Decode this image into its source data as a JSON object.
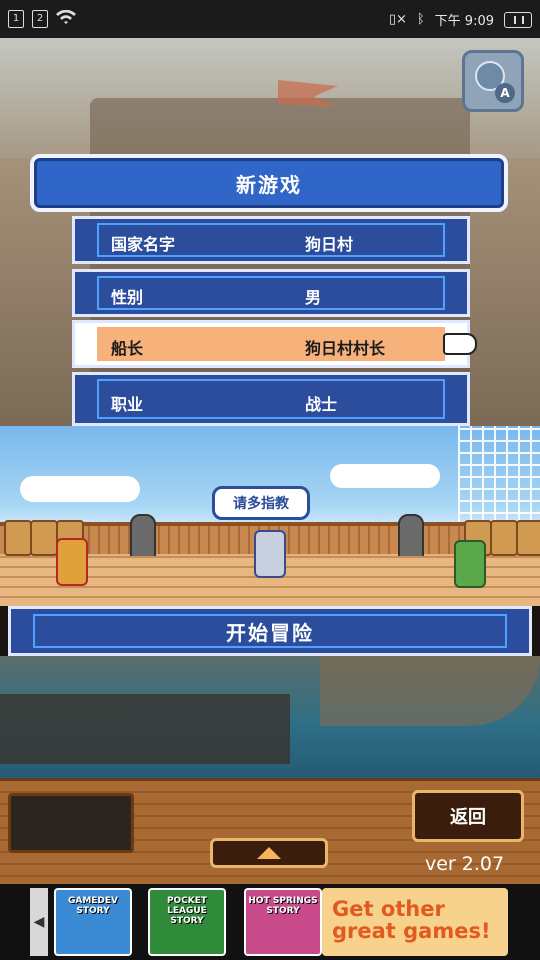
{
  "status_bar": {
    "sim1": "1",
    "sim2": "2",
    "time": "下午 9:09"
  },
  "menu": {
    "title": "新游戏",
    "rows": [
      {
        "label": "国家名字",
        "value": "狗日村"
      },
      {
        "label": "性别",
        "value": "男"
      },
      {
        "label": "船长",
        "value": "狗日村村长"
      },
      {
        "label": "职业",
        "value": "战士"
      }
    ],
    "selected_index": 2
  },
  "scene": {
    "speech": "请多指教"
  },
  "start_button": "开始冒险",
  "back_button": "返回",
  "version": "ver 2.07",
  "ad": {
    "games": [
      {
        "title": "GAMEDEV STORY",
        "color": "#3b8bd4"
      },
      {
        "title": "POCKET LEAGUE STORY",
        "color": "#2f8a3a"
      },
      {
        "title": "HOT SPRINGS STORY",
        "color": "#c94a8a"
      }
    ],
    "cta": "Get other great games!"
  },
  "colors": {
    "menu_blue": "#2c4d9c",
    "selected_row": "#f6b27a",
    "title_blue": "#2f66c8"
  }
}
